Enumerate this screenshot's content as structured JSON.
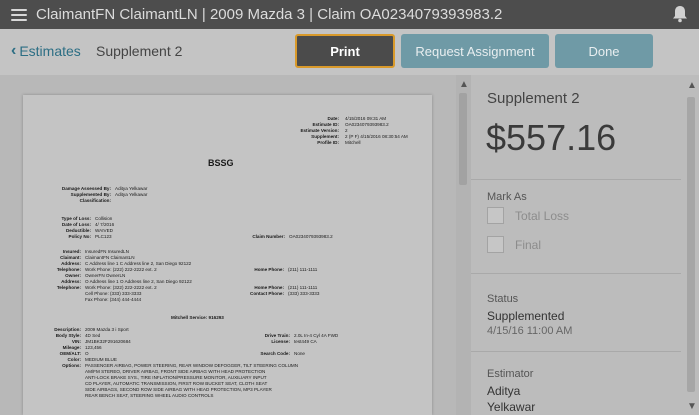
{
  "header": {
    "title": "ClaimantFN ClaimantLN | 2009 Mazda 3 | Claim OA0234079393983.2",
    "menu_icon": "hamburger-menu-icon",
    "bell_icon": "bell-icon"
  },
  "subheader": {
    "back_label": "Estimates",
    "page_title": "Supplement 2",
    "print_label": "Print",
    "request_label": "Request Assignment",
    "done_label": "Done"
  },
  "document": {
    "meta": [
      {
        "label": "Date:",
        "value": "4/15/2016 09:31 AM"
      },
      {
        "label": "Estimate ID:",
        "value": "OA0234079393983.2"
      },
      {
        "label": "Estimate Version:",
        "value": "2"
      },
      {
        "label": "Supplement:",
        "value": "2 (P F)   4/15/2016 08:30:54 AM"
      },
      {
        "label": "Profile ID:",
        "value": "Mitchell"
      }
    ],
    "heading": "BSSG",
    "assessed": [
      {
        "label": "Damage Assessed By:",
        "value": "Aditya Yelkawar"
      },
      {
        "label": "Supplemented By:",
        "value": "Aditya Yelkawar"
      },
      {
        "label": "Classification:",
        "value": ""
      }
    ],
    "loss": [
      {
        "label": "Type of Loss:",
        "value": "Collision"
      },
      {
        "label": "Date of Loss:",
        "value": "4/ 7/2016"
      },
      {
        "label": "Deductible:",
        "value": "WAIVED"
      },
      {
        "label": "Policy No:",
        "value": "PLC123"
      }
    ],
    "claim_label": "Claim Number:",
    "claim_value": "OA0234079393983.2",
    "parties": [
      {
        "label": "Insured:",
        "value": "InsuredFN InsuredLN"
      },
      {
        "label": "Claimant:",
        "value": "ClaimantFN ClaimantLN"
      },
      {
        "label": "Address:",
        "value": "C Address line 1 C Address line 2, San Diego 92122"
      },
      {
        "label": "Telephone:",
        "value": "Work Phone:          (222) 222-2222 ext. 2"
      },
      {
        "label": "Owner:",
        "value": "OwnerFN OwnerLN"
      },
      {
        "label": "Address:",
        "value": "O Address line 1 O Address line 2, San Diego 92122"
      },
      {
        "label": "Telephone:",
        "value": "Work Phone:          (322) 222-2222 ext. 2"
      },
      {
        "label": "",
        "value": "Cell Phone:            (333) 333-3333"
      },
      {
        "label": "",
        "value": "Fax Phone:             (344) 444-4444"
      }
    ],
    "phones_right": [
      {
        "label": "Home Phone:",
        "value": "(211) 111-1111"
      },
      {
        "label": "Home Phone:",
        "value": "(211) 111-1111"
      },
      {
        "label": "Contact Phone:",
        "value": "(333) 333-3333"
      }
    ],
    "mitchell_service": "Mitchell Service:    916293",
    "vehicle": [
      {
        "label": "Description:",
        "value": "2009 Mazda 3 i Sport"
      },
      {
        "label": "Body Style:",
        "value": "4D Sed"
      },
      {
        "label": "VIN:",
        "value": "JM1BK32F291620684"
      },
      {
        "label": "Mileage:",
        "value": "123,456"
      },
      {
        "label": "OEM/ALT:",
        "value": "O"
      },
      {
        "label": "Color:",
        "value": "MEDIUM BLUE"
      },
      {
        "label": "Options:",
        "value": "PASSENGER AIRBAG, POWER STEERING, REAR WINDOW DEFOGGER, TILT STEERING COLUMN"
      }
    ],
    "vehicle_right": [
      {
        "label": "Drive Train:",
        "value": "2.0L In-4 Cyl 4A FWD"
      },
      {
        "label": "License:",
        "value": "test449  CA"
      },
      {
        "label": "Search Code:",
        "value": "None"
      }
    ],
    "options_more": [
      "AM/FM STEREO, DRIVER AIRBAG, FRONT SIDE AIRBAG WITH HEAD PROTECTION",
      "ANTI-LOCK BRAKE SYS., TIRE INFLATION/PRESSURE MONITOR, AUXILIARY INPUT",
      "CD PLAYER, AUTOMATIC TRANSMISSION, FIRST ROW BUCKET SEAT, CLOTH SEAT",
      "SIDE AIRBAGS, SECOND ROW SIDE AIRBAG WITH HEAD PROTECTION, MP3 PLAYER",
      "REAR BENCH SEAT, STEERING WHEEL AUDIO CONTROLS"
    ]
  },
  "sidebar": {
    "title": "Supplement 2",
    "amount": "$557.16",
    "mark_as_label": "Mark As",
    "mark_options": [
      "Total Loss",
      "Final"
    ],
    "status_label": "Status",
    "status_value": "Supplemented",
    "status_date": "4/15/16 11:00 AM",
    "estimator_label": "Estimator",
    "estimator_first": "Aditya",
    "estimator_last": "Yelkawar"
  },
  "colors": {
    "accent": "#2c6e84",
    "print_border": "#d99a2b",
    "secondary_button": "#6f9aa6"
  }
}
